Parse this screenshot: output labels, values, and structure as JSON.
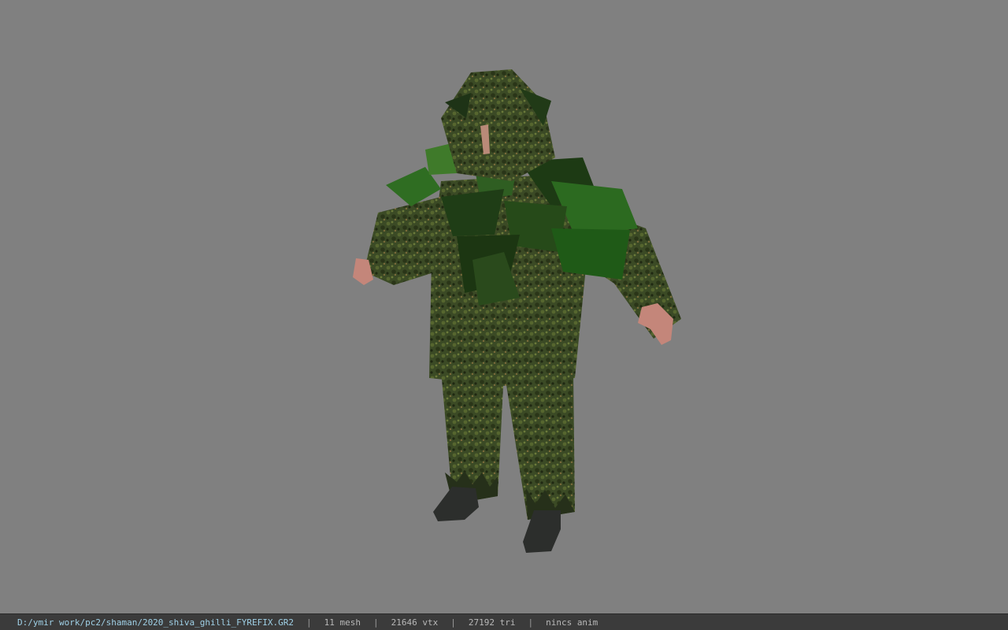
{
  "viewer": {
    "background_color": "#808080"
  },
  "model": {
    "name": "ghillie-suit-character"
  },
  "status": {
    "file_path": "D:/ymir work/pc2/shaman/2020_shiva_ghilli_FYREFIX.GR2",
    "mesh_count": "11 mesh",
    "vertex_count": "21646 vtx",
    "triangle_count": "27192 tri",
    "animation": "nincs anim",
    "separator": "|"
  }
}
